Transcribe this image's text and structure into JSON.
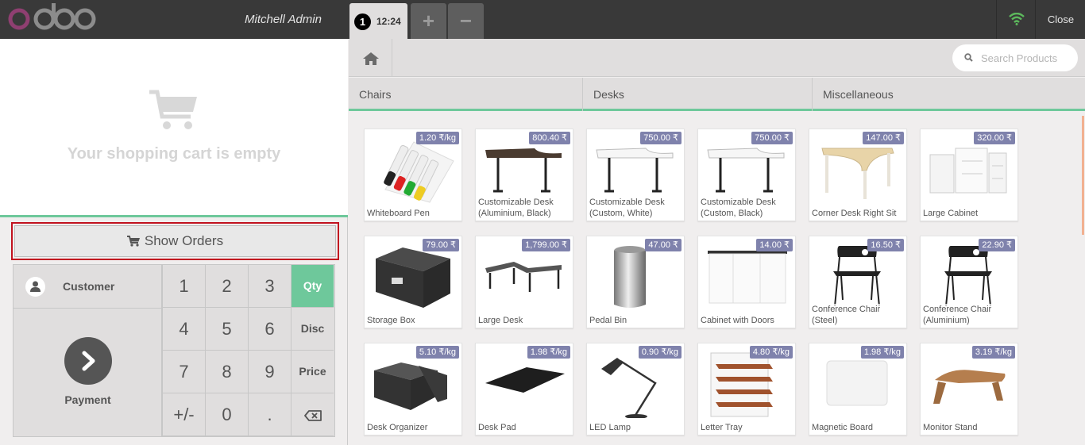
{
  "header": {
    "logo_text": "odoo",
    "cashier": "Mitchell Admin",
    "order_number": "1",
    "order_time": "12:24",
    "add_order": "+",
    "remove_order": "−",
    "close_label": "Close",
    "status_color": "#5cb85c"
  },
  "cart": {
    "empty_text": "Your shopping cart is empty"
  },
  "show_orders_label": "Show Orders",
  "control": {
    "customer_label": "Customer",
    "payment_label": "Payment",
    "keys": [
      "1",
      "2",
      "3",
      "Qty",
      "4",
      "5",
      "6",
      "Disc",
      "7",
      "8",
      "9",
      "Price",
      "+/-",
      "0",
      ".",
      "⌫"
    ],
    "selected_mode": "Qty"
  },
  "search": {
    "placeholder": "Search Products"
  },
  "categories": [
    "Chairs",
    "Desks",
    "Miscellaneous"
  ],
  "colors": {
    "accent": "#6ec89b",
    "price_tag": "#7f82ac",
    "highlight": "#c1121f"
  },
  "products": [
    {
      "name": "Whiteboard Pen",
      "price": "1.20 ₹/kg",
      "icon": "whiteboard-pen-icon"
    },
    {
      "name": "Customizable Desk (Aluminium, Black)",
      "price": "800.40 ₹",
      "icon": "desk-icon"
    },
    {
      "name": "Customizable Desk (Custom, White)",
      "price": "750.00 ₹",
      "icon": "desk-icon"
    },
    {
      "name": "Customizable Desk (Custom, Black)",
      "price": "750.00 ₹",
      "icon": "desk-icon"
    },
    {
      "name": "Corner Desk Right Sit",
      "price": "147.00 ₹",
      "icon": "corner-desk-icon"
    },
    {
      "name": "Large Cabinet",
      "price": "320.00 ₹",
      "icon": "cabinet-icon"
    },
    {
      "name": "Storage Box",
      "price": "79.00 ₹",
      "icon": "storage-box-icon"
    },
    {
      "name": "Large Desk",
      "price": "1,799.00 ₹",
      "icon": "large-desk-icon"
    },
    {
      "name": "Pedal Bin",
      "price": "47.00 ₹",
      "icon": "pedal-bin-icon"
    },
    {
      "name": "Cabinet with Doors",
      "price": "14.00 ₹",
      "icon": "cabinet-doors-icon"
    },
    {
      "name": "Conference Chair (Steel)",
      "price": "16.50 ₹",
      "icon": "chair-icon"
    },
    {
      "name": "Conference Chair (Aluminium)",
      "price": "22.90 ₹",
      "icon": "chair-icon"
    },
    {
      "name": "Desk Organizer",
      "price": "5.10 ₹/kg",
      "icon": "desk-organizer-icon"
    },
    {
      "name": "Desk Pad",
      "price": "1.98 ₹/kg",
      "icon": "desk-pad-icon"
    },
    {
      "name": "LED Lamp",
      "price": "0.90 ₹/kg",
      "icon": "lamp-icon"
    },
    {
      "name": "Letter Tray",
      "price": "4.80 ₹/kg",
      "icon": "letter-tray-icon"
    },
    {
      "name": "Magnetic Board",
      "price": "1.98 ₹/kg",
      "icon": "magnetic-board-icon"
    },
    {
      "name": "Monitor Stand",
      "price": "3.19 ₹/kg",
      "icon": "monitor-stand-icon"
    }
  ]
}
